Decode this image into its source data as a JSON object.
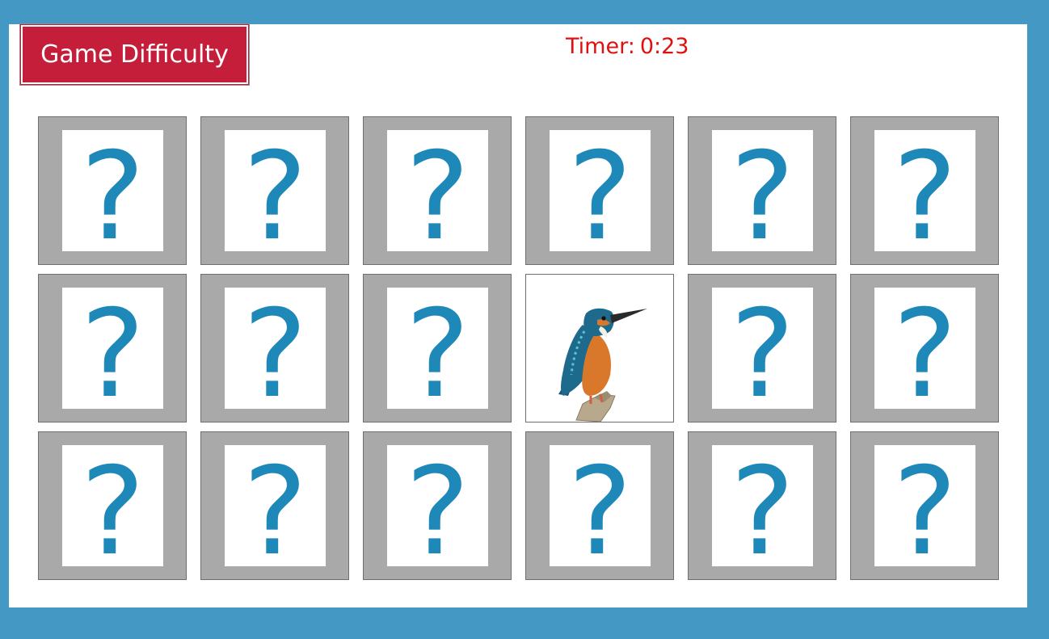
{
  "header": {
    "difficulty_label": "Game Difficulty",
    "timer_label": "Timer:",
    "timer_value": "0:23"
  },
  "colors": {
    "page_bg": "#4499c4",
    "button_bg": "#c41e3a",
    "timer_text": "#e01010",
    "card_back": "#a9a9a9",
    "question_mark": "#1e88b8"
  },
  "board": {
    "rows": 3,
    "cols": 6,
    "hidden_symbol": "?",
    "cards": [
      {
        "state": "hidden"
      },
      {
        "state": "hidden"
      },
      {
        "state": "hidden"
      },
      {
        "state": "hidden"
      },
      {
        "state": "hidden"
      },
      {
        "state": "hidden"
      },
      {
        "state": "hidden"
      },
      {
        "state": "hidden"
      },
      {
        "state": "hidden"
      },
      {
        "state": "revealed",
        "image": "kingfisher-bird"
      },
      {
        "state": "hidden"
      },
      {
        "state": "hidden"
      },
      {
        "state": "hidden"
      },
      {
        "state": "hidden"
      },
      {
        "state": "hidden"
      },
      {
        "state": "hidden"
      },
      {
        "state": "hidden"
      },
      {
        "state": "hidden"
      }
    ]
  }
}
